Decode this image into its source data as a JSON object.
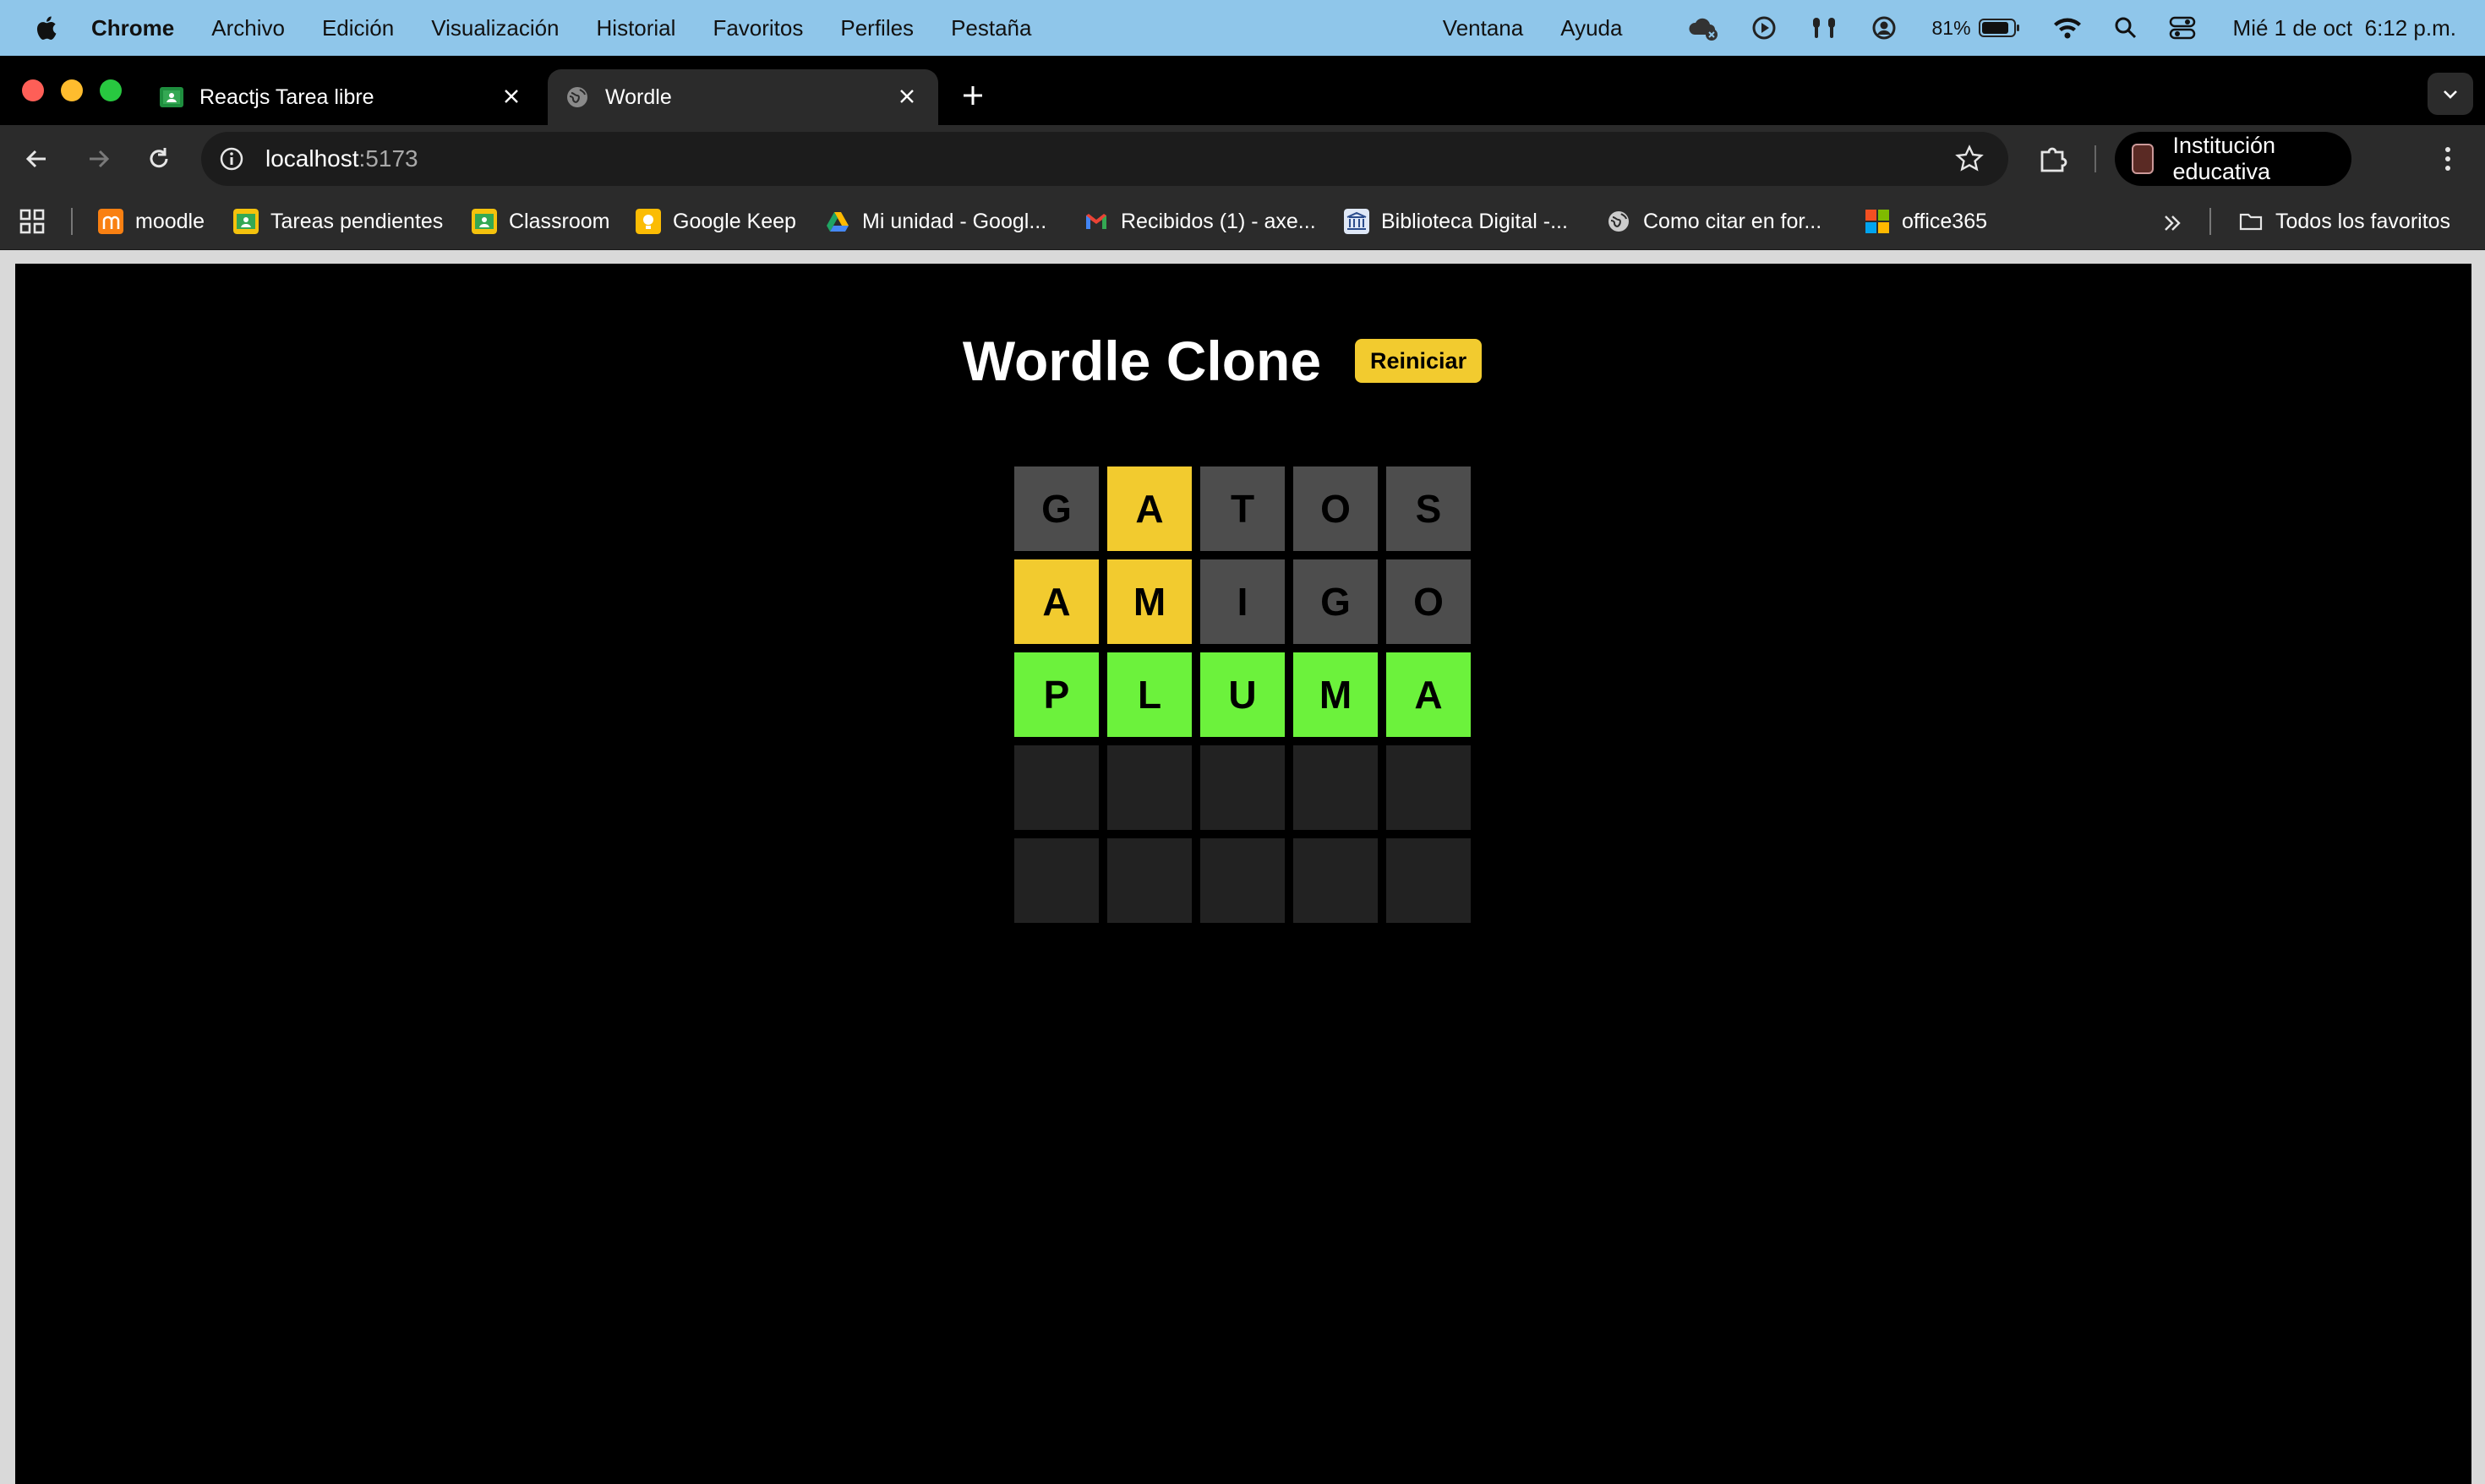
{
  "menubar": {
    "app_name": "Chrome",
    "items": [
      "Archivo",
      "Edición",
      "Visualización",
      "Historial",
      "Favoritos",
      "Perfiles",
      "Pestaña"
    ],
    "right_items": [
      "Ventana",
      "Ayuda"
    ],
    "battery": "81%",
    "datetime": "Mié 1 de oct  6:12 p.m."
  },
  "tabs": [
    {
      "title": "Reactjs Tarea libre",
      "active": false,
      "icon": "google-classroom-icon"
    },
    {
      "title": "Wordle",
      "active": true,
      "icon": "globe-icon"
    }
  ],
  "omnibox": {
    "host": "localhost",
    "port": ":5173"
  },
  "profile": {
    "label": "Institución educativa"
  },
  "bookmarks": [
    {
      "label": "moodle",
      "icon": "moodle-icon",
      "color": "#f98012"
    },
    {
      "label": "Tareas pendientes",
      "icon": "classroom-icon",
      "color": "#f4c20d"
    },
    {
      "label": "Classroom",
      "icon": "classroom-icon",
      "color": "#f4c20d"
    },
    {
      "label": "Google Keep",
      "icon": "keep-icon",
      "color": "#fbbc04"
    },
    {
      "label": "Mi unidad - Googl...",
      "icon": "drive-icon",
      "color": "#1fa463"
    },
    {
      "label": "Recibidos (1) - axe...",
      "icon": "gmail-icon",
      "color": "#ea4335"
    },
    {
      "label": "Biblioteca Digital -...",
      "icon": "library-icon",
      "color": "#8fb0e8"
    },
    {
      "label": "Como citar en for...",
      "icon": "globe-icon",
      "color": "#cccccc"
    },
    {
      "label": "office365",
      "icon": "microsoft-icon",
      "color": "#f25022"
    }
  ],
  "bookmarks_all": "Todos los favoritos",
  "game": {
    "title": "Wordle Clone",
    "reset_label": "Reiniciar",
    "rows": [
      [
        {
          "letter": "G",
          "state": "absent"
        },
        {
          "letter": "A",
          "state": "present"
        },
        {
          "letter": "T",
          "state": "absent"
        },
        {
          "letter": "O",
          "state": "absent"
        },
        {
          "letter": "S",
          "state": "absent"
        }
      ],
      [
        {
          "letter": "A",
          "state": "present"
        },
        {
          "letter": "M",
          "state": "present"
        },
        {
          "letter": "I",
          "state": "absent"
        },
        {
          "letter": "G",
          "state": "absent"
        },
        {
          "letter": "O",
          "state": "absent"
        }
      ],
      [
        {
          "letter": "P",
          "state": "correct"
        },
        {
          "letter": "L",
          "state": "correct"
        },
        {
          "letter": "U",
          "state": "correct"
        },
        {
          "letter": "M",
          "state": "correct"
        },
        {
          "letter": "A",
          "state": "correct"
        }
      ],
      [
        {
          "letter": "",
          "state": "empty"
        },
        {
          "letter": "",
          "state": "empty"
        },
        {
          "letter": "",
          "state": "empty"
        },
        {
          "letter": "",
          "state": "empty"
        },
        {
          "letter": "",
          "state": "empty"
        }
      ],
      [
        {
          "letter": "",
          "state": "empty"
        },
        {
          "letter": "",
          "state": "empty"
        },
        {
          "letter": "",
          "state": "empty"
        },
        {
          "letter": "",
          "state": "empty"
        },
        {
          "letter": "",
          "state": "empty"
        }
      ]
    ],
    "colors": {
      "absent": "#4d4d4d",
      "present": "#f2cb2f",
      "correct": "#6cf23c",
      "empty": "#222222"
    }
  }
}
